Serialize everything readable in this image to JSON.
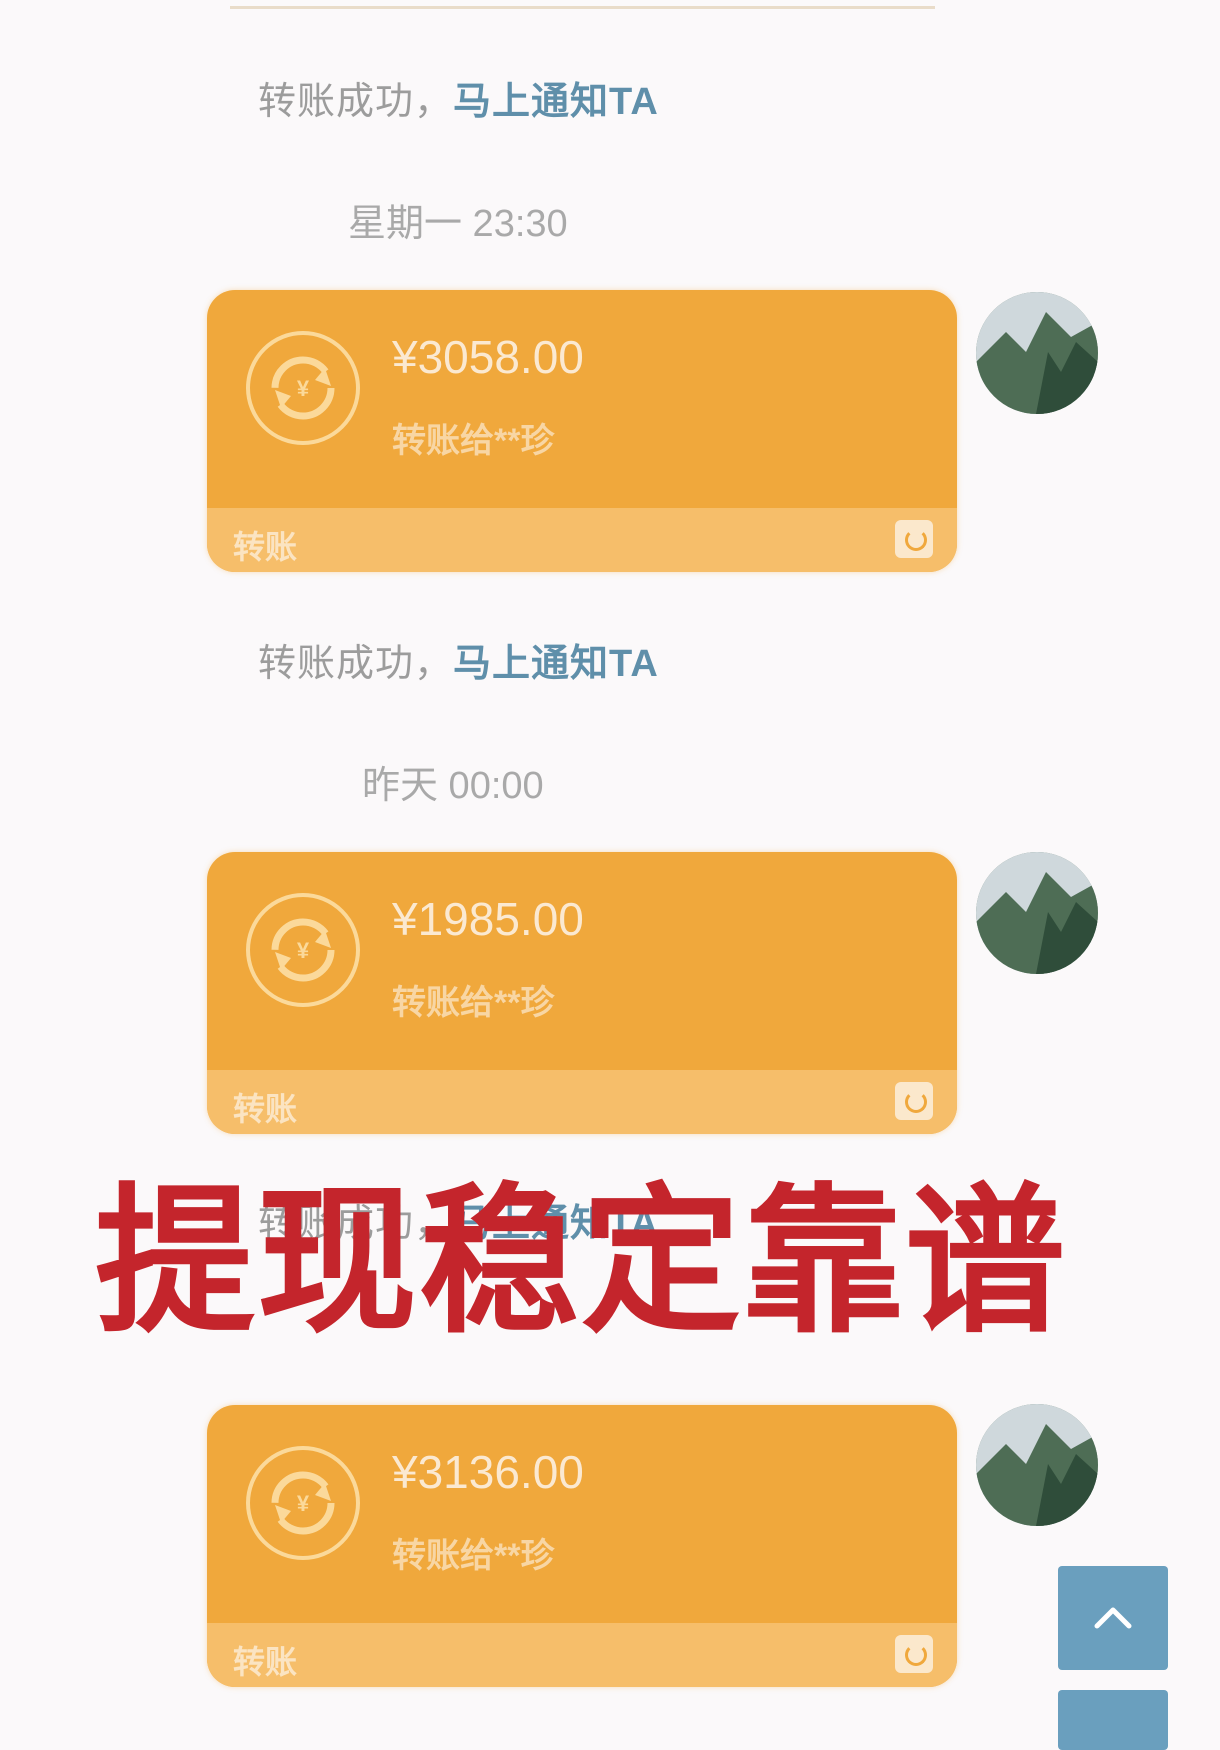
{
  "notices": [
    {
      "text": "转账成功，",
      "link": "马上通知TA"
    },
    {
      "text": "转账成功，",
      "link": "马上通知TA"
    },
    {
      "text": "转账成功，",
      "link": "马上通知TA"
    }
  ],
  "timestamps": [
    "星期一 23:30",
    "昨天 00:00"
  ],
  "transfers": [
    {
      "amount": "¥3058.00",
      "recipient": "转账给**珍",
      "footer_label": "转账"
    },
    {
      "amount": "¥1985.00",
      "recipient": "转账给**珍",
      "footer_label": "转账"
    },
    {
      "amount": "¥3136.00",
      "recipient": "转账给**珍",
      "footer_label": "转账"
    }
  ],
  "watermark": "提现稳定靠谱",
  "colors": {
    "card": "#f0a83c",
    "card_footer": "#f6be6a",
    "link": "#5f8faa",
    "watermark": "#c4252c",
    "scroll_button": "#6a9fbe"
  },
  "icons": {
    "transfer": "transfer-arrows-icon",
    "footer": "wallet-icon",
    "scroll": "chevron-up-icon"
  }
}
